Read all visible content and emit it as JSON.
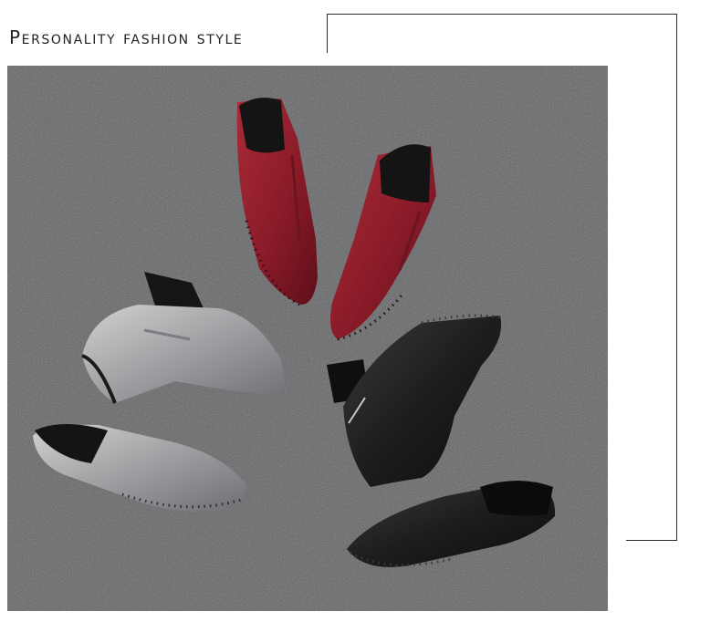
{
  "heading": {
    "text": "Personality fashion style"
  },
  "photo": {
    "subject_icon": "ankle-boots-photo",
    "colors": {
      "carpet": "#5f6062",
      "red_leather": "#8f1f2c",
      "silver_leather": "#a8a8aa",
      "black_leather": "#1b1b1d"
    }
  }
}
